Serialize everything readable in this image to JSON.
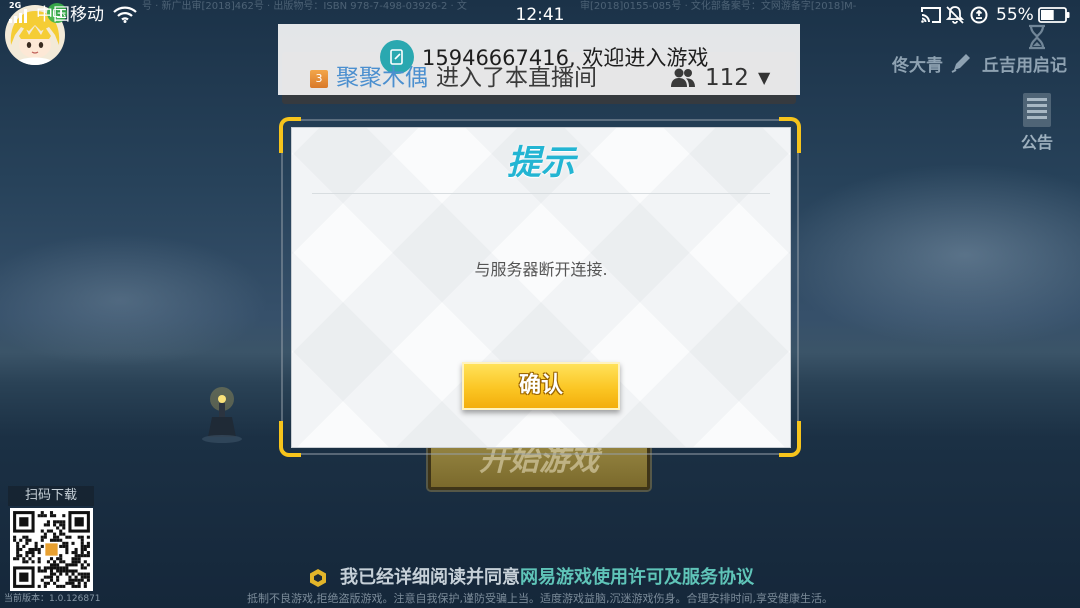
{
  "status_bar": {
    "network_type": "2G",
    "carrier": "中国移动",
    "time": "12:41",
    "battery": "55%",
    "icons": [
      "signal-icon",
      "wifi-icon",
      "cast-icon",
      "bell-off-icon",
      "data-saver-icon",
      "battery-icon"
    ]
  },
  "license_text": {
    "left": "号 · 新广出审[2018]462号 · 出版物号：ISBN 978-7-498-03926-2 · 文",
    "right": "审[2018]0155-085号 · 文化部备案号：文网游备字[2018]M-"
  },
  "toast": {
    "icon": "note-edit-icon",
    "message": "15946667416, 欢迎进入游戏"
  },
  "live_bar": {
    "rank_badge": "3",
    "user_name": "聚聚木偶",
    "action": "进入了本直播间",
    "viewer_icon": "viewers-icon",
    "viewer_count": "112",
    "dropdown": "▼"
  },
  "account": {
    "user_name": "佟大青",
    "server_name": "丘吉用启记"
  },
  "notice": {
    "icon": "notice-board-icon",
    "label": "公告"
  },
  "dialog": {
    "title": "提示",
    "message": "与服务器断开连接.",
    "confirm_label": "确认"
  },
  "start_button": {
    "label": "开始游戏"
  },
  "download": {
    "label": "扫码下载"
  },
  "version": "当前版本：1.0.126871",
  "agreement": {
    "prefix": "我已经详细阅读并同意",
    "link": "网易游戏使用许可及服务协议"
  },
  "disclaimer": "抵制不良游戏,拒绝盗版游戏。注意自我保护,谨防受骗上当。适度游戏益脑,沉迷游戏伤身。合理安排时间,享受健康生活。",
  "colors": {
    "accent_yellow": "#f6c41c",
    "title_teal": "#23b5d3",
    "link_teal": "#5fc4b8",
    "live_name_blue": "#4b8fcf",
    "toast_icon": "#2aa8b0"
  }
}
